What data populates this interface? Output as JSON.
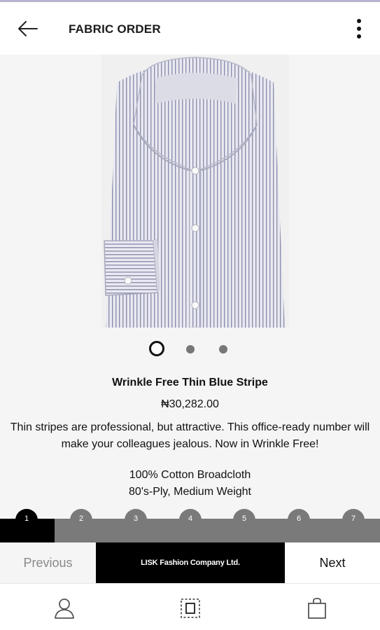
{
  "header": {
    "title": "FABRIC ORDER",
    "back_icon": "arrow-left-icon",
    "more_icon": "more-vertical-icon"
  },
  "carousel": {
    "count": 3,
    "active_index": 0
  },
  "product": {
    "name": "Wrinkle Free Thin Blue Stripe",
    "price": "₦30,282.00",
    "description": "Thin stripes are professional, but attractive. This office-ready number will make your colleagues jealous. Now in Wrinkle Free!",
    "spec_lines": [
      "100% Cotton Broadcloth",
      "80's-Ply, Medium Weight"
    ]
  },
  "steps": {
    "labels": [
      "1",
      "2",
      "3",
      "4",
      "5",
      "6",
      "7"
    ],
    "active": 1
  },
  "actions": {
    "previous_label": "Previous",
    "brand_label": "LISK Fashion Company Ltd.",
    "next_label": "Next"
  },
  "nav": {
    "items": [
      "user-icon",
      "fabric-frame-icon",
      "shopping-bag-icon"
    ]
  },
  "colors": {
    "accent": "#000000",
    "inactive": "#7a7a7a",
    "top_line": "#b9b3d3"
  }
}
